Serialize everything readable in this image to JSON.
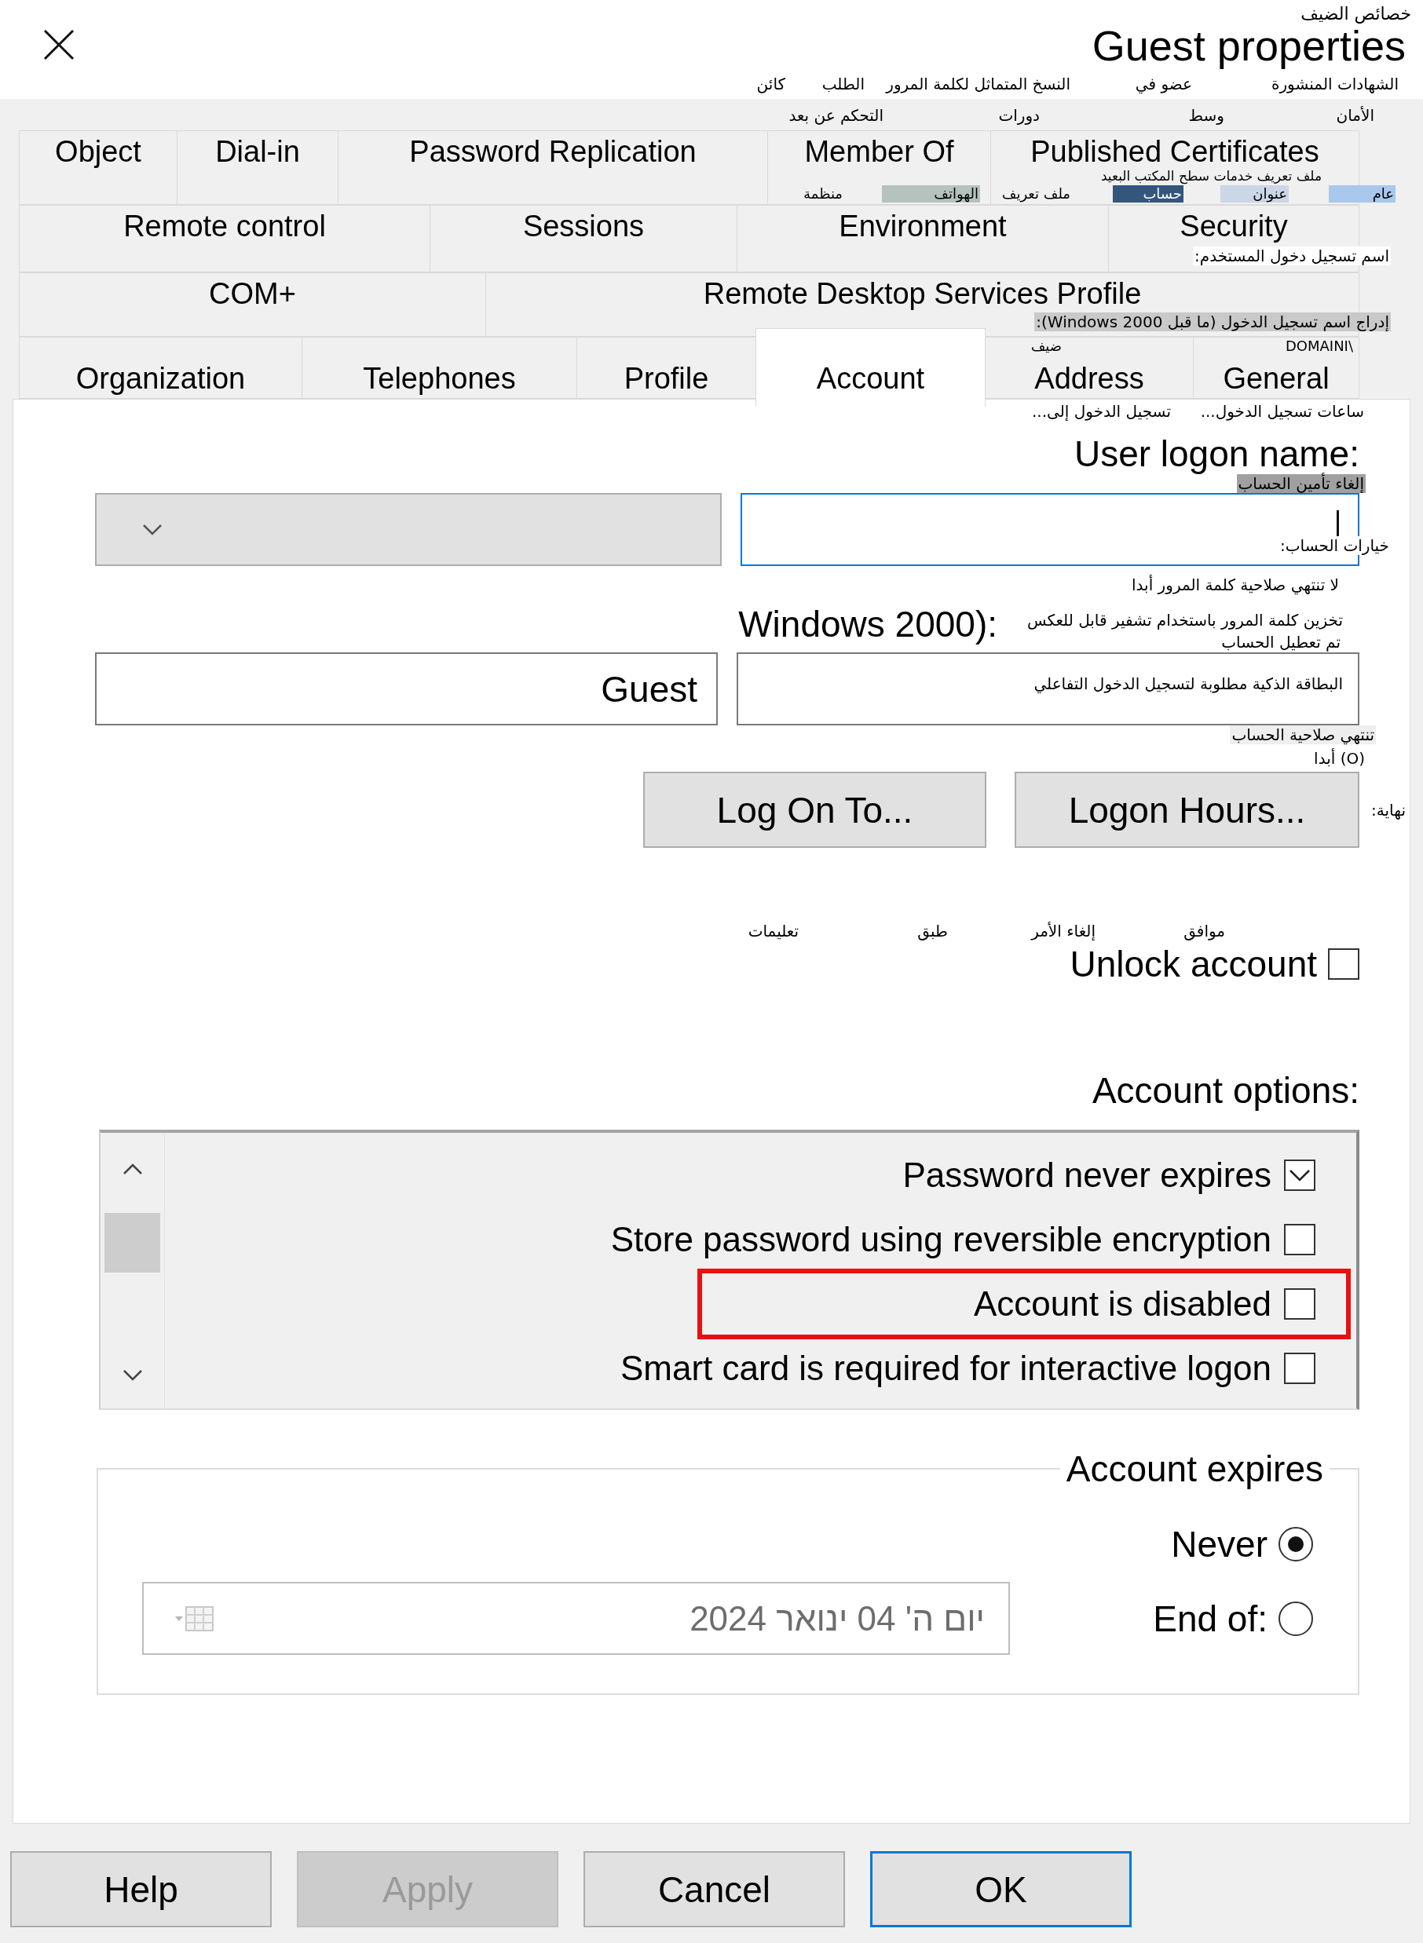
{
  "window": {
    "title": "Guest properties"
  },
  "tab_rows": [
    [
      {
        "label": "Published Certificates",
        "selected": false
      },
      {
        "label": "Member Of",
        "selected": false
      },
      {
        "label": "Password Replication",
        "selected": false
      },
      {
        "label": "Dial-in",
        "selected": false
      },
      {
        "label": "Object",
        "selected": false
      }
    ],
    [
      {
        "label": "Security",
        "selected": false
      },
      {
        "label": "Environment",
        "selected": false
      },
      {
        "label": "Sessions",
        "selected": false
      },
      {
        "label": "Remote control",
        "selected": false
      }
    ],
    [
      {
        "label": "Remote Desktop Services Profile",
        "selected": false
      },
      {
        "label": "COM+",
        "selected": false
      }
    ],
    [
      {
        "label": "General",
        "selected": false
      },
      {
        "label": "Address",
        "selected": false
      },
      {
        "label": "Account",
        "selected": true
      },
      {
        "label": "Profile",
        "selected": false
      },
      {
        "label": "Telephones",
        "selected": false
      },
      {
        "label": "Organization",
        "selected": false
      }
    ]
  ],
  "logon_name": {
    "label": "User logon name:",
    "focused": true
  },
  "domain_dropdown": {
    "disabled": true
  },
  "pre2000": {
    "label": "Windows 2000):",
    "user": "Guest"
  },
  "panel_buttons": [
    {
      "label": "Logon Hours..."
    },
    {
      "label": "Log On To..."
    }
  ],
  "unlock": {
    "label": "Unlock account",
    "checked": false
  },
  "account_options": {
    "label": "Account options:",
    "items": [
      {
        "label": "Password never expires",
        "checked": true,
        "highlighted": false
      },
      {
        "label": "Store password using reversible encryption",
        "checked": false,
        "highlighted": false
      },
      {
        "label": "Account is disabled",
        "checked": false,
        "highlighted": true
      },
      {
        "label": "Smart card is required for interactive logon",
        "checked": false,
        "highlighted": false
      }
    ]
  },
  "account_expires": {
    "legend": "Account expires",
    "options": [
      {
        "label": "Never",
        "selected": true
      },
      {
        "label": "End of:",
        "selected": false
      }
    ],
    "date_field": {
      "value": "יום ה' 04 ינואר 2024",
      "disabled": true
    }
  },
  "dialog_buttons": [
    {
      "label": "OK",
      "default": true,
      "disabled": false
    },
    {
      "label": "Cancel",
      "default": false,
      "disabled": false
    },
    {
      "label": "Apply",
      "default": false,
      "disabled": true
    },
    {
      "label": "Help",
      "default": false,
      "disabled": false
    }
  ],
  "translations": [
    {
      "text": "خصائص الضيف"
    },
    {
      "text": "الشهادات المنشورة"
    },
    {
      "text": "عضو في"
    },
    {
      "text": "النسخ المتماثل لكلمة المرور"
    },
    {
      "text": "الطلب"
    },
    {
      "text": "كائن"
    },
    {
      "text": "الأمان"
    },
    {
      "text": "وسط"
    },
    {
      "text": "دورات"
    },
    {
      "text": "التحكم عن بعد"
    },
    {
      "text": "ملف تعريف خدمات سطح المكتب البعيد"
    },
    {
      "text": "عام"
    },
    {
      "text": "عنوان"
    },
    {
      "text": "حساب"
    },
    {
      "text": "ملف تعريف"
    },
    {
      "text": "الهواتف"
    },
    {
      "text": "منظمة"
    },
    {
      "text": "اسم تسجيل دخول المستخدم:"
    },
    {
      "text": "إدراج اسم تسجيل الدخول (ما قبل Windows 2000):"
    },
    {
      "text": "\\DOMAINI"
    },
    {
      "text": "ضيف"
    },
    {
      "text": "ساعات تسجيل الدخول..."
    },
    {
      "text": "تسجيل الدخول إلى..."
    },
    {
      "text": "إلغاء تأمين الحساب"
    },
    {
      "text": "خيارات الحساب:"
    },
    {
      "text": "لا تنتهي صلاحية كلمة المرور أبدا"
    },
    {
      "text": "تخزين كلمة المرور باستخدام تشفير قابل للعكس"
    },
    {
      "text": "تم تعطيل الحساب"
    },
    {
      "text": "البطاقة الذكية مطلوبة لتسجيل الدخول التفاعلي"
    },
    {
      "text": "تنتهي صلاحية الحساب"
    },
    {
      "text": "(O) أبدا"
    },
    {
      "text": "نهاية:"
    },
    {
      "text": "موافق"
    },
    {
      "text": "إلغاء الأمر"
    },
    {
      "text": "طبق"
    },
    {
      "text": "تعليمات"
    }
  ]
}
